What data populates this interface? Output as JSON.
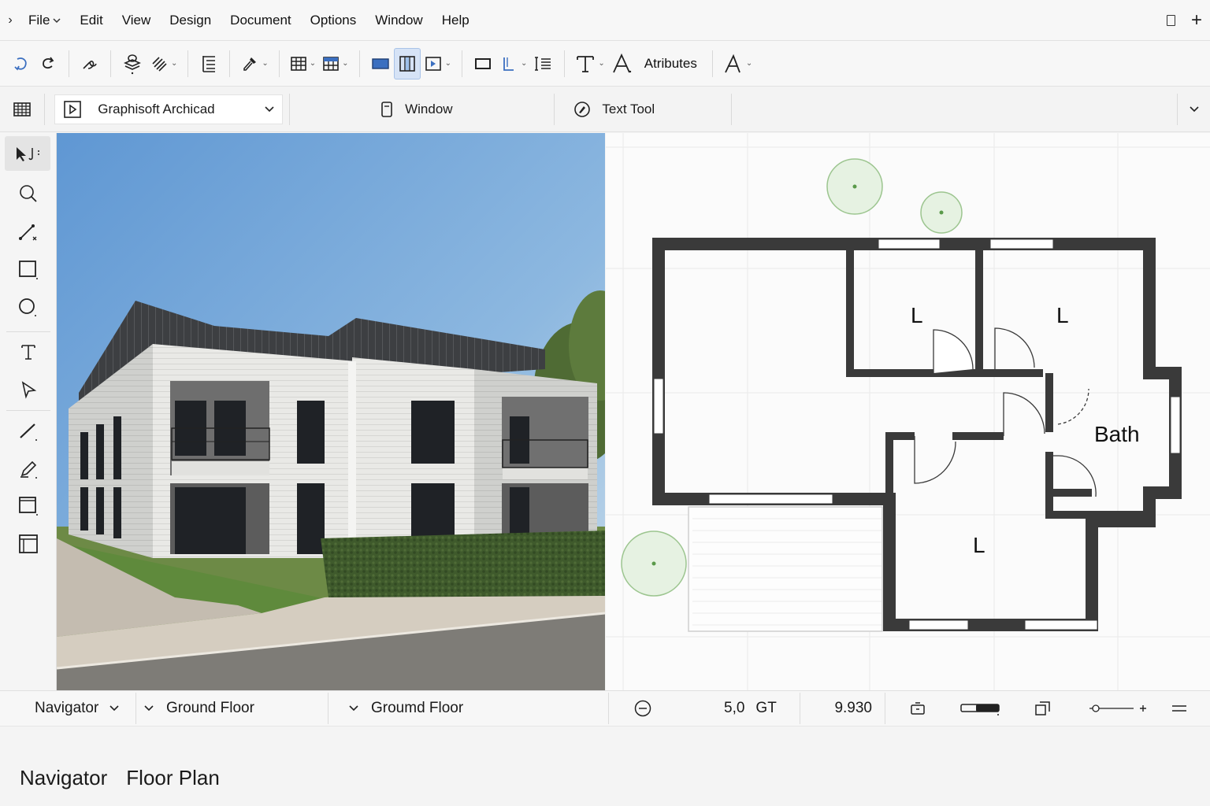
{
  "menu": {
    "items": [
      {
        "label": "File",
        "has_dropdown": true
      },
      {
        "label": "Edit"
      },
      {
        "label": "View"
      },
      {
        "label": "Design"
      },
      {
        "label": "Document"
      },
      {
        "label": "Options"
      },
      {
        "label": "Window"
      },
      {
        "label": "Help"
      }
    ]
  },
  "toolbar": {
    "attributes_label": "Atributes"
  },
  "secondbar": {
    "app_selector": "Graphisoft Archicad",
    "window_label": "Window",
    "text_tool_label": "Text Tool"
  },
  "plan": {
    "rooms": [
      {
        "label": "L"
      },
      {
        "label": "L"
      },
      {
        "label": "Bath"
      },
      {
        "label": "L"
      }
    ]
  },
  "statusbar": {
    "navigator": "Navigator",
    "floor1": "Ground Floor",
    "floor2": "Groumd Floor",
    "scale_value": "5,0",
    "scale_unit": "GT",
    "coord_value": "9.930"
  },
  "tabs": [
    {
      "label": "Navigator"
    },
    {
      "label": "Floor Plan"
    }
  ],
  "colors": {
    "accent": "#4a7fd0",
    "active_tool_bg": "#d6e3f6",
    "wall": "#3a3a3a",
    "tree": "#cfe6c8"
  }
}
